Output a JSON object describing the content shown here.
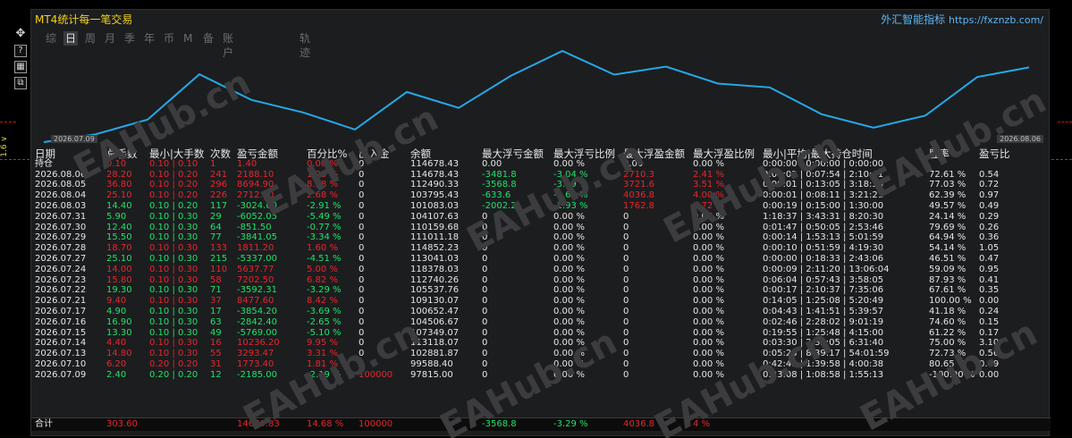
{
  "title": "MT4统计每一笔交易",
  "brand": {
    "name": "外汇智能指标",
    "url": "https://fxznzb.com/"
  },
  "side_price": "1.6 ∨",
  "tabs": [
    {
      "label": "综",
      "active": false
    },
    {
      "label": "日",
      "active": true
    },
    {
      "label": "周",
      "active": false
    },
    {
      "label": "月",
      "active": false
    },
    {
      "label": "季",
      "active": false
    },
    {
      "label": "年",
      "active": false
    },
    {
      "label": "币",
      "active": false
    },
    {
      "label": "M",
      "active": false
    },
    {
      "label": "备",
      "active": false
    },
    {
      "label": "账户",
      "active": false
    },
    {
      "label": "轨迹",
      "active": false
    }
  ],
  "graph": {
    "start_date": "2026.07.09",
    "end_date": "2026.08.06",
    "line_color": "#25a9e8"
  },
  "chart_data": {
    "type": "line",
    "x": [
      "2026.07.09",
      "2026.07.10",
      "2026.07.13",
      "2026.07.14",
      "2026.07.15",
      "2026.07.16",
      "2026.07.17",
      "2026.07.21",
      "2026.07.22",
      "2026.07.23",
      "2026.07.24",
      "2026.07.27",
      "2026.07.28",
      "2026.07.29",
      "2026.07.30",
      "2026.07.31",
      "2026.08.03",
      "2026.08.04",
      "2026.08.05",
      "2026.08.06"
    ],
    "series": [
      {
        "values": [
          97815.0,
          99588.4,
          102881.87,
          113118.07,
          107349.07,
          104506.67,
          100652.47,
          109130.07,
          105537.76,
          112740.26,
          118378.03,
          113041.03,
          114852.23,
          111011.18,
          110159.68,
          104107.63,
          101083.03,
          103795.43,
          112490.33,
          114678.43
        ]
      }
    ]
  },
  "headers": [
    "日期",
    "总手数",
    "最小|大手数",
    "次数",
    "盈亏金额",
    "百分比%",
    "出入金",
    "余额",
    "最大浮亏金额",
    "最大浮亏比例",
    "最大浮盈金额",
    "最大浮盈比例",
    "最小|平均|最大持仓时间",
    "胜率",
    "盈亏比"
  ],
  "hold_row": {
    "label": "持仓",
    "lots": "0.10",
    "minmax": "0.10 | 0.10",
    "count": "1",
    "pnl": "1.40",
    "pct": "0.00 %",
    "flow": "0",
    "balance": "114678.43",
    "maxfl": "0.00",
    "maxflp": "0.00 %",
    "maxfp": "0.00",
    "maxfpp": "0.00 %",
    "time": "0:00:00 | 0:00:00 | 0:00:00",
    "win": "",
    "rr": ""
  },
  "rows": [
    {
      "date": "2026.08.06",
      "lots": "28.20",
      "minmax": "0.10 | 0.20",
      "count": "241",
      "pnl": "2188.10",
      "pct": "1.95 %",
      "flow": "0",
      "balance": "114678.43",
      "maxfl": "-3481.8",
      "maxflp": "-3.04 %",
      "maxfp": "2710.3",
      "maxfpp": "2.41 %",
      "time": "0:00:03 | 0:07:54 | 2:10:41",
      "win": "72.61 %",
      "rr": "0.54",
      "up": true
    },
    {
      "date": "2026.08.05",
      "lots": "36.80",
      "minmax": "0.10 | 0.20",
      "count": "296",
      "pnl": "8694.90",
      "pct": "8.38 %",
      "flow": "0",
      "balance": "112490.33",
      "maxfl": "-3568.8",
      "maxflp": "-3.29 %",
      "maxfp": "3721.6",
      "maxfpp": "3.51 %",
      "time": "0:00:01 | 0:13:05 | 3:18:33",
      "win": "77.03 %",
      "rr": "0.72",
      "up": true
    },
    {
      "date": "2026.08.04",
      "lots": "25.10",
      "minmax": "0.10 | 0.20",
      "count": "226",
      "pnl": "2712.40",
      "pct": "2.68 %",
      "flow": "0",
      "balance": "103795.43",
      "maxfl": "-633.6",
      "maxflp": "-0.62 %",
      "maxfp": "4036.8",
      "maxfpp": "4.00 %",
      "time": "0:00:01 | 0:08:11 | 3:21:21",
      "win": "62.39 %",
      "rr": "0.97",
      "up": true
    },
    {
      "date": "2026.08.03",
      "lots": "14.40",
      "minmax": "0.10 | 0.20",
      "count": "117",
      "pnl": "-3024.60",
      "pct": "-2.91 %",
      "flow": "0",
      "balance": "101083.03",
      "maxfl": "-2002.2",
      "maxflp": "-1.93 %",
      "maxfp": "1762.8",
      "maxfpp": "1.72 %",
      "time": "0:00:19 | 0:15:00 | 1:30:00",
      "win": "49.57 %",
      "rr": "0.49",
      "up": false
    },
    {
      "date": "2026.07.31",
      "lots": "5.90",
      "minmax": "0.10 | 0.30",
      "count": "29",
      "pnl": "-6052.05",
      "pct": "-5.49 %",
      "flow": "0",
      "balance": "104107.63",
      "maxfl": "0",
      "maxflp": "0.00 %",
      "maxfp": "0",
      "maxfpp": "0.00 %",
      "time": "1:18:37 | 3:43:31 | 8:20:30",
      "win": "24.14 %",
      "rr": "0.29",
      "up": false
    },
    {
      "date": "2026.07.30",
      "lots": "12.40",
      "minmax": "0.10 | 0.30",
      "count": "64",
      "pnl": "-851.50",
      "pct": "-0.77 %",
      "flow": "0",
      "balance": "110159.68",
      "maxfl": "0",
      "maxflp": "0.00 %",
      "maxfp": "0",
      "maxfpp": "0.00 %",
      "time": "0:01:47 | 0:50:05 | 2:53:46",
      "win": "79.69 %",
      "rr": "0.26",
      "up": false
    },
    {
      "date": "2026.07.29",
      "lots": "15.50",
      "minmax": "0.10 | 0.30",
      "count": "77",
      "pnl": "-3841.05",
      "pct": "-3.34 %",
      "flow": "0",
      "balance": "111011.18",
      "maxfl": "0",
      "maxflp": "0.00 %",
      "maxfp": "0",
      "maxfpp": "0.00 %",
      "time": "0:00:14 | 1:53:13 | 5:01:59",
      "win": "64.94 %",
      "rr": "0.36",
      "up": false
    },
    {
      "date": "2026.07.28",
      "lots": "18.70",
      "minmax": "0.10 | 0.30",
      "count": "133",
      "pnl": "1811.20",
      "pct": "1.60 %",
      "flow": "0",
      "balance": "114852.23",
      "maxfl": "0",
      "maxflp": "0.00 %",
      "maxfp": "0",
      "maxfpp": "0.00 %",
      "time": "0:00:10 | 0:51:59 | 4:19:30",
      "win": "54.14 %",
      "rr": "1.05",
      "up": true
    },
    {
      "date": "2026.07.27",
      "lots": "25.10",
      "minmax": "0.10 | 0.30",
      "count": "215",
      "pnl": "-5337.00",
      "pct": "-4.51 %",
      "flow": "0",
      "balance": "113041.03",
      "maxfl": "0",
      "maxflp": "0.00 %",
      "maxfp": "0",
      "maxfpp": "0.00 %",
      "time": "0:00:00 | 0:18:33 | 2:43:06",
      "win": "46.51 %",
      "rr": "0.47",
      "up": false
    },
    {
      "date": "2026.07.24",
      "lots": "14.00",
      "minmax": "0.10 | 0.30",
      "count": "110",
      "pnl": "5637.77",
      "pct": "5.00 %",
      "flow": "0",
      "balance": "118378.03",
      "maxfl": "0",
      "maxflp": "0.00 %",
      "maxfp": "0",
      "maxfpp": "0.00 %",
      "time": "0:00:09 | 2:11:20 | 13:06:04",
      "win": "59.09 %",
      "rr": "0.95",
      "up": true
    },
    {
      "date": "2026.07.23",
      "lots": "15.80",
      "minmax": "0.10 | 0.30",
      "count": "58",
      "pnl": "7202.50",
      "pct": "6.82 %",
      "flow": "0",
      "balance": "112740.26",
      "maxfl": "0",
      "maxflp": "0.00 %",
      "maxfp": "0",
      "maxfpp": "0.00 %",
      "time": "0:06:04 | 0:57:43 | 3:58:05",
      "win": "87.93 %",
      "rr": "0.41",
      "up": true
    },
    {
      "date": "2026.07.22",
      "lots": "19.30",
      "minmax": "0.10 | 0.30",
      "count": "71",
      "pnl": "-3592.31",
      "pct": "-3.29 %",
      "flow": "0",
      "balance": "105537.76",
      "maxfl": "0",
      "maxflp": "0.00 %",
      "maxfp": "0",
      "maxfpp": "0.00 %",
      "time": "0:00:17 | 2:10:37 | 7:35:06",
      "win": "67.61 %",
      "rr": "0.35",
      "up": false
    },
    {
      "date": "2026.07.21",
      "lots": "9.40",
      "minmax": "0.10 | 0.30",
      "count": "37",
      "pnl": "8477.60",
      "pct": "8.42 %",
      "flow": "0",
      "balance": "109130.07",
      "maxfl": "0",
      "maxflp": "0.00 %",
      "maxfp": "0",
      "maxfpp": "0.00 %",
      "time": "0:14:05 | 1:25:08 | 5:20:49",
      "win": "100.00 %",
      "rr": "0.00",
      "up": true
    },
    {
      "date": "2026.07.17",
      "lots": "4.90",
      "minmax": "0.10 | 0.30",
      "count": "17",
      "pnl": "-3854.20",
      "pct": "-3.69 %",
      "flow": "0",
      "balance": "100652.47",
      "maxfl": "0",
      "maxflp": "0.00 %",
      "maxfp": "0",
      "maxfpp": "0.00 %",
      "time": "0:04:43 | 1:41:51 | 5:39:57",
      "win": "41.18 %",
      "rr": "0.24",
      "up": false
    },
    {
      "date": "2026.07.16",
      "lots": "16.90",
      "minmax": "0.10 | 0.30",
      "count": "63",
      "pnl": "-2842.40",
      "pct": "-2.65 %",
      "flow": "0",
      "balance": "104506.67",
      "maxfl": "0",
      "maxflp": "0.00 %",
      "maxfp": "0",
      "maxfpp": "0.00 %",
      "time": "0:02:46 | 2:28:02 | 9:01:19",
      "win": "74.60 %",
      "rr": "0.15",
      "up": false
    },
    {
      "date": "2026.07.15",
      "lots": "13.30",
      "minmax": "0.10 | 0.30",
      "count": "49",
      "pnl": "-5769.00",
      "pct": "-5.10 %",
      "flow": "0",
      "balance": "107349.07",
      "maxfl": "0",
      "maxflp": "0.00 %",
      "maxfp": "0",
      "maxfpp": "0.00 %",
      "time": "0:19:55 | 1:25:48 | 4:15:00",
      "win": "61.22 %",
      "rr": "0.17",
      "up": false
    },
    {
      "date": "2026.07.14",
      "lots": "4.40",
      "minmax": "0.10 | 0.30",
      "count": "16",
      "pnl": "10236.20",
      "pct": "9.95 %",
      "flow": "0",
      "balance": "113118.07",
      "maxfl": "0",
      "maxflp": "0.00 %",
      "maxfp": "0",
      "maxfpp": "0.00 %",
      "time": "0:03:30 | 2:32:05 | 6:31:40",
      "win": "75.00 %",
      "rr": "3.10",
      "up": true
    },
    {
      "date": "2026.07.13",
      "lots": "14.80",
      "minmax": "0.10 | 0.30",
      "count": "55",
      "pnl": "3293.47",
      "pct": "3.31 %",
      "flow": "0",
      "balance": "102881.87",
      "maxfl": "0",
      "maxflp": "0.00 %",
      "maxfp": "0",
      "maxfpp": "0.00 %",
      "time": "0:05:23 | 8:39:17 | 54:01:59",
      "win": "72.73 %",
      "rr": "0.56",
      "up": true
    },
    {
      "date": "2026.07.10",
      "lots": "6.20",
      "minmax": "0.20 | 0.20",
      "count": "31",
      "pnl": "1773.40",
      "pct": "1.81 %",
      "flow": "0",
      "balance": "99588.40",
      "maxfl": "0",
      "maxflp": "0.00 %",
      "maxfp": "0",
      "maxfpp": "0.00 %",
      "time": "0:42:41 | 1:39:58 | 4:00:38",
      "win": "80.65 %",
      "rr": "0.49",
      "up": true
    },
    {
      "date": "2026.07.09",
      "lots": "2.40",
      "minmax": "0.20 | 0.20",
      "count": "12",
      "pnl": "-2185.00",
      "pct": "-2.19 %",
      "flow": "100000",
      "balance": "97815.00",
      "maxfl": "0",
      "maxflp": "0.00 %",
      "maxfp": "0",
      "maxfpp": "0.00 %",
      "time": "0:23:08 | 1:08:58 | 1:55:13",
      "win": "-100.00 %",
      "rr": "0.00",
      "up": false
    }
  ],
  "total": {
    "label": "合计",
    "lots": "303.60",
    "pnl": "14679.83",
    "pct": "14.68 %",
    "flow": "100000",
    "maxfl": "-3568.8",
    "maxflp": "-3.29 %",
    "maxfp": "4036.8",
    "maxfpp": "4 %"
  },
  "watermark": "EAHub.cn"
}
